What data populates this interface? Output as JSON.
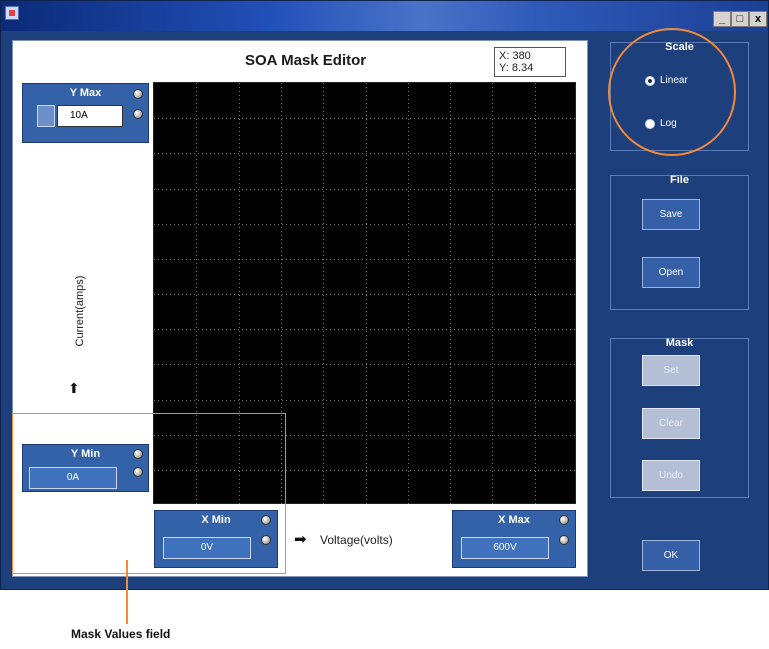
{
  "window": {
    "controls": [
      "_",
      "□",
      "x"
    ]
  },
  "editor": {
    "title": "SOA Mask Editor",
    "coord_x": "X: 380",
    "coord_y": "Y: 8.34"
  },
  "mask_values": {
    "y_max": {
      "label": "Y Max",
      "value": "10A"
    },
    "y_min": {
      "label": "Y Min",
      "value": "0A"
    },
    "x_min": {
      "label": "X Min",
      "value": "0V"
    },
    "x_max": {
      "label": "X Max",
      "value": "600V"
    },
    "y_axis_label": "Current(amps)",
    "x_axis_label": "Voltage(volts)"
  },
  "scale": {
    "title": "Scale",
    "options": [
      {
        "label": "Linear",
        "selected": true
      },
      {
        "label": "Log",
        "selected": false
      }
    ]
  },
  "file": {
    "title": "File",
    "save": "Save",
    "open": "Open"
  },
  "mask": {
    "title": "Mask",
    "set": "Set",
    "clear": "Clear",
    "undo": "Undo"
  },
  "ok": "OK",
  "annotation": {
    "label": "Mask Values field"
  },
  "colors": {
    "window_bg": "#1d3f7c",
    "plot_bg": "#000000",
    "grid": "#7a7a7a",
    "annotation": "#f28a3a",
    "button": "#3560a8"
  }
}
